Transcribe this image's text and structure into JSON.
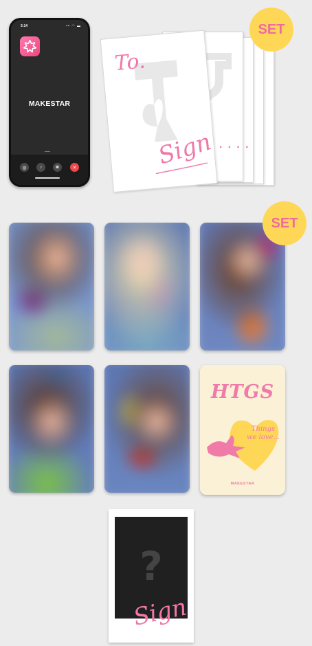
{
  "phone": {
    "time": "3:14",
    "status_icons": "▪▪ ◠ ▬",
    "brand": "MAKESTAR",
    "app_icon": "star-burst-icon",
    "call_buttons": [
      "speaker-icon",
      "mic-icon",
      "camera-icon",
      "end-call-icon"
    ],
    "call_glyphs": [
      "◍",
      "♪",
      "◙",
      "✕"
    ]
  },
  "sign_cards": {
    "to_text": "To.",
    "sign_text": "Sign",
    "dots_text": ". . . .",
    "badge": "SET"
  },
  "photocards": {
    "badge": "SET",
    "count": 5
  },
  "htgs_card": {
    "title": "HTGS",
    "heart_text": "Things we love...",
    "brand": "MAKESTAR"
  },
  "polaroid": {
    "mark": "?",
    "sign_text": "Sign"
  },
  "colors": {
    "pink": "#f078a8",
    "yellow": "#ffd757",
    "cream": "#fbf1d6",
    "background": "#ececec"
  }
}
